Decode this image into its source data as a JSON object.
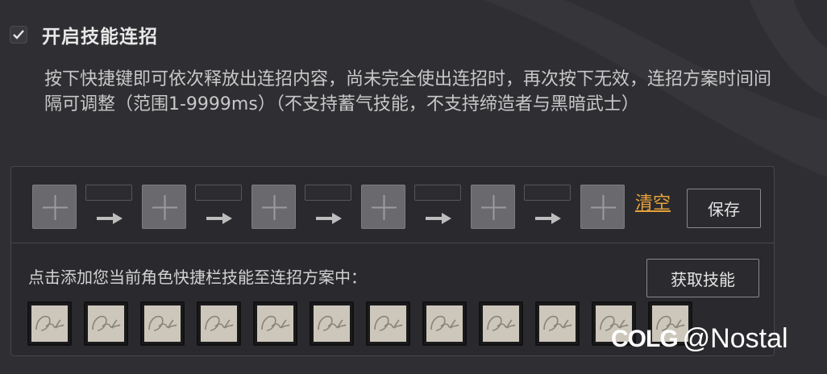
{
  "header": {
    "checkbox_checked": true,
    "title": "开启技能连招"
  },
  "description": "按下快捷键即可依次释放出连招内容，尚未完全使出连招时，再次按下无效，连招方案时间间隔可调整（范围1-9999ms）（不支持蓄气技能，不支持缔造者与黑暗武士）",
  "combo": {
    "slot_count": 6,
    "slot_icon": "plus-icon",
    "delay_count": 5,
    "clear_label": "清空",
    "save_label": "保存"
  },
  "skills_section": {
    "instruction": "点击添加您当前角色快捷栏技能至连招方案中：",
    "get_label": "获取技能",
    "skill_count": 12,
    "skill_icon": "dnf-logo-icon"
  },
  "watermark": {
    "logo": "COLG",
    "handle": "@Nostal"
  },
  "colors": {
    "background": "#2f2f33",
    "accent": "#e8a23a",
    "slot": "#6a6a6e",
    "skill_tile": "#cdc7bb"
  }
}
